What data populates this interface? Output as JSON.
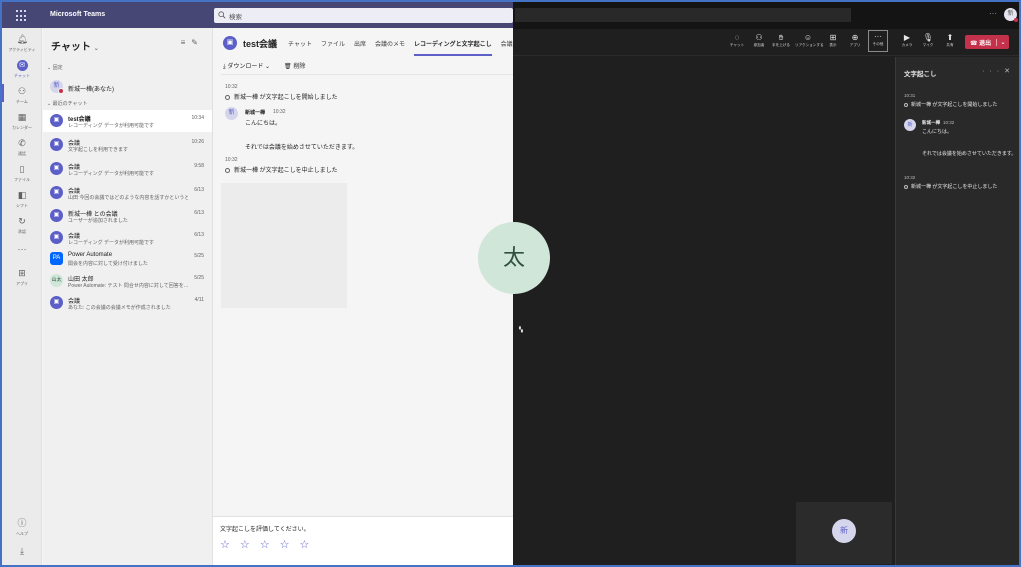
{
  "teams": {
    "app_title": "Microsoft Teams",
    "search_placeholder": "検索",
    "rail": [
      {
        "label": "アクティビティ",
        "icon": "bell-icon"
      },
      {
        "label": "チャット",
        "icon": "chat-icon"
      },
      {
        "label": "チーム",
        "icon": "teams-icon"
      },
      {
        "label": "カレンダー",
        "icon": "calendar-icon"
      },
      {
        "label": "通話",
        "icon": "phone-icon"
      },
      {
        "label": "ファイル",
        "icon": "file-icon"
      },
      {
        "label": "シフト",
        "icon": "shifts-icon"
      },
      {
        "label": "承認",
        "icon": "approvals-icon"
      },
      {
        "label": "アプリ",
        "icon": "apps-icon"
      },
      {
        "label": "ヘルプ",
        "icon": "help-icon"
      }
    ],
    "chatlist": {
      "header": "チャット",
      "pinned_label": "固定",
      "pinned": {
        "name": "新城一樺(あなた)",
        "avatar": "新"
      },
      "recent_label": "最近のチャット",
      "items": [
        {
          "name": "test会議",
          "preview": "レコーディング データが利用可能です",
          "time": "10:34",
          "avatar": "",
          "selected": true
        },
        {
          "name": "会議",
          "preview": "文字起こしを利用できます",
          "time": "10:26",
          "avatar": ""
        },
        {
          "name": "会議",
          "preview": "レコーディング データが利用可能です",
          "time": "9:58",
          "avatar": ""
        },
        {
          "name": "会議",
          "preview": "山田 今回の会議ではどのような内容を話すかというと…",
          "time": "6/13",
          "avatar": ""
        },
        {
          "name": "新城一樺 との会議",
          "preview": "ユーザーが追加されました",
          "time": "6/13",
          "avatar": ""
        },
        {
          "name": "会議",
          "preview": "レコーディング データが利用可能です",
          "time": "6/13",
          "avatar": ""
        },
        {
          "name": "Power Automate",
          "preview": "関会を内容に対して受け付けました",
          "time": "5/25",
          "avatar": "PA"
        },
        {
          "name": "山田 太郎",
          "preview": "Power Automate: テスト 問合せ内容に対して回答を…",
          "time": "5/25",
          "avatar": "山太"
        },
        {
          "name": "会議",
          "preview": "あなた: この会議の会議メモが作成されました",
          "time": "4/11",
          "avatar": ""
        }
      ]
    },
    "main": {
      "title": "test会議",
      "tabs": [
        "チャット",
        "ファイル",
        "出席",
        "会議のメモ",
        "レコーディングと文字起こし",
        "会議ホワイトボ"
      ],
      "active_tab": "レコーディングと文字起こし",
      "download_label": "ダウンロード",
      "delete_label": "削除",
      "transcript": {
        "start_time": "10:32",
        "start_event": "新城一樺 が文字起こしを開始しました",
        "speaker": "新城一樺",
        "speaker_avatar": "新",
        "speaker_time": "10:32",
        "line1": "こんにちは。",
        "line2": "それでは会議を始めさせていただきます。",
        "stop_time": "10:32",
        "stop_event": "新城一樺 が文字起こしを中止しました"
      },
      "rating_question": "文字起こしを評価してください。",
      "rating_stars": 5
    }
  },
  "meeting": {
    "top_avatar": "新",
    "controls": [
      {
        "label": "チャット",
        "icon": "chat-bubble-icon"
      },
      {
        "label": "参加者",
        "icon": "people-icon"
      },
      {
        "label": "手を上げる",
        "icon": "raise-hand-icon"
      },
      {
        "label": "リアクションする",
        "icon": "smiley-icon"
      },
      {
        "label": "表示",
        "icon": "view-icon"
      },
      {
        "label": "アプリ",
        "icon": "add-app-icon"
      },
      {
        "label": "その他",
        "icon": "more-icon"
      },
      {
        "label": "カメラ",
        "icon": "camera-icon"
      },
      {
        "label": "マイク",
        "icon": "mic-icon"
      },
      {
        "label": "共有",
        "icon": "share-icon"
      }
    ],
    "leave_label": "退出",
    "participant_initial": "太",
    "self_initial": "新",
    "panel": {
      "title": "文字起こし",
      "start_time": "10:31",
      "start_event": "新城一樺 が文字起こしを開始しました",
      "speaker": "新城一樺",
      "speaker_time": "10:32",
      "speaker_avatar": "新",
      "line1": "こんにちは。",
      "line2": "それでは会議を始めさせていただきます。",
      "stop_time": "10:32",
      "stop_event": "新城一樺 が文字起こしを中止しました"
    }
  },
  "colors": {
    "accent": "#5b5fc7",
    "titlebar": "#464775",
    "leave": "#c4314b",
    "frame": "#4472c4"
  }
}
